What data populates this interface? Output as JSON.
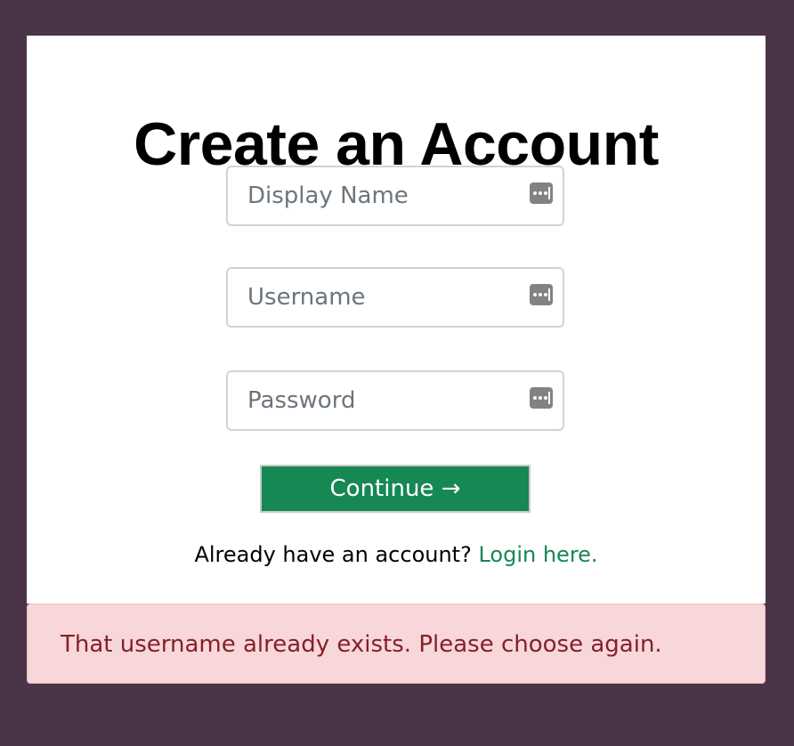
{
  "page": {
    "title": "Create an Account"
  },
  "form": {
    "display_name": {
      "placeholder": "Display Name",
      "value": "",
      "icon": "password-manager-key-icon"
    },
    "username": {
      "placeholder": "Username",
      "value": "",
      "icon": "password-manager-key-icon"
    },
    "password": {
      "placeholder": "Password",
      "value": "",
      "icon": "password-manager-key-icon"
    },
    "continue_label": "Continue →"
  },
  "footer": {
    "prompt": "Already have an account?",
    "login_link": "Login here."
  },
  "alert": {
    "message": "That username already exists. Please choose again."
  },
  "colors": {
    "background": "#4a3548",
    "card": "#ffffff",
    "accent": "#158853",
    "alert_bg": "#f8d7da",
    "alert_text": "#842029"
  }
}
